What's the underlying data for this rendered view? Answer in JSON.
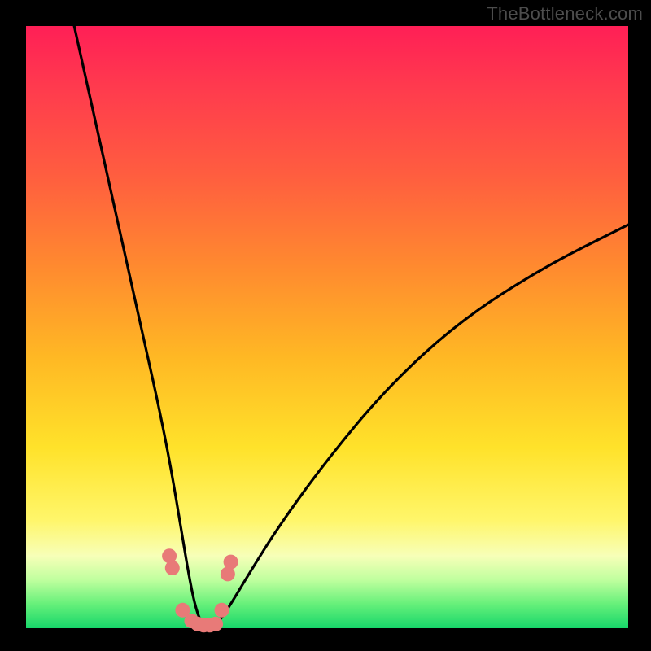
{
  "watermark": "TheBottleneck.com",
  "colors": {
    "curve_stroke": "#000000",
    "dot_fill": "#e87a78",
    "gradient_top": "#ff1f56",
    "gradient_bottom": "#17d66a",
    "frame": "#000000"
  },
  "chart_data": {
    "type": "line",
    "title": "",
    "xlabel": "",
    "ylabel": "",
    "xlim": [
      0,
      100
    ],
    "ylim": [
      0,
      100
    ],
    "grid": false,
    "legend": false,
    "note": "Axes are unlabeled percentages estimated from pixel position. Curve is a V-shape with minimum near x≈29 touching y≈0, rising steeply left to y≈100 and more gently to the right to y≈67.",
    "series": [
      {
        "name": "bottleneck-curve",
        "color": "#000000",
        "x": [
          8,
          10,
          12,
          14,
          16,
          18,
          20,
          22,
          24,
          26,
          27,
          28,
          29,
          30,
          31,
          32,
          34,
          37,
          42,
          50,
          60,
          72,
          86,
          100
        ],
        "y": [
          100,
          91,
          82,
          73,
          64,
          55,
          46,
          37,
          27,
          15,
          9,
          4,
          1,
          0.5,
          0.5,
          1,
          4,
          9,
          17,
          28,
          40,
          51,
          60,
          67
        ]
      }
    ],
    "markers": {
      "name": "highlight-dots",
      "color": "#e87a78",
      "x": [
        23.8,
        24.3,
        26.0,
        27.5,
        28.5,
        29.5,
        30.5,
        31.5,
        32.5,
        33.5,
        34.0
      ],
      "y": [
        12.0,
        10.0,
        3.0,
        1.2,
        0.7,
        0.5,
        0.5,
        0.7,
        3.0,
        9.0,
        11.0
      ]
    }
  }
}
